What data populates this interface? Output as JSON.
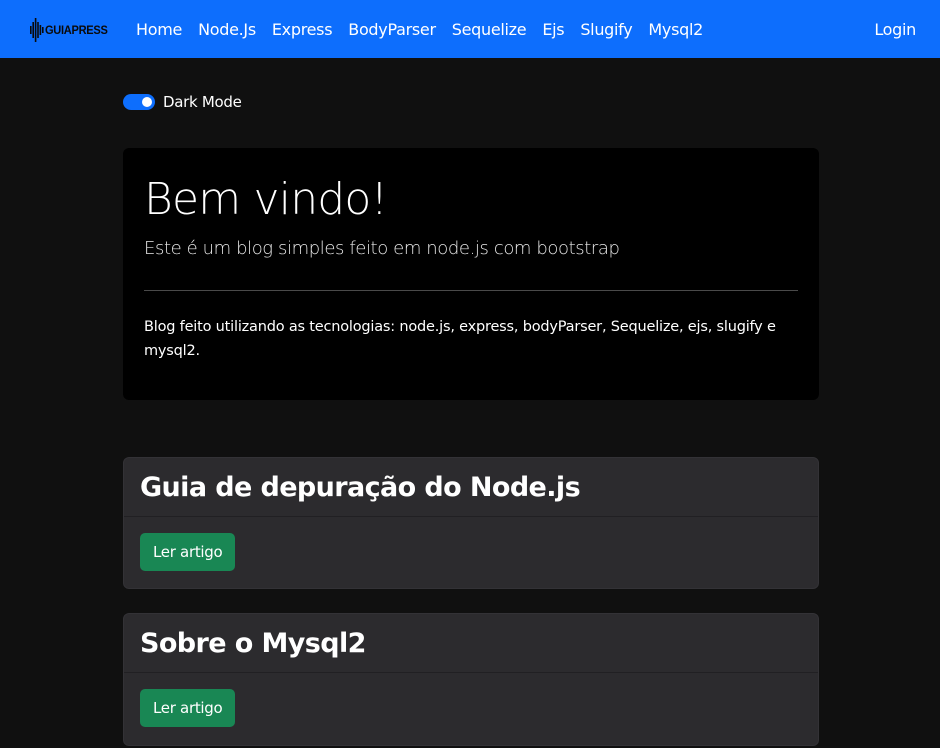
{
  "navbar": {
    "brand": "GUIAPRESS",
    "links": [
      "Home",
      "Node.Js",
      "Express",
      "BodyParser",
      "Sequelize",
      "Ejs",
      "Slugify",
      "Mysql2"
    ],
    "login": "Login",
    "color": "#0d6efd"
  },
  "theme_toggle": {
    "label": "Dark Mode",
    "checked": true
  },
  "jumbotron": {
    "title": "Bem vindo!",
    "lead": "Este é um blog simples feito em node.js com bootstrap",
    "text": "Blog feito utilizando as tecnologias: node.js, express, bodyParser, Sequelize, ejs, slugify e mysql2."
  },
  "articles": [
    {
      "title": "Guia de depuração do Node.js",
      "button": "Ler artigo"
    },
    {
      "title": "Sobre o Mysql2",
      "button": "Ler artigo"
    }
  ],
  "colors": {
    "background": "#101010",
    "card": "#2c2b2e",
    "button": "#198754"
  }
}
